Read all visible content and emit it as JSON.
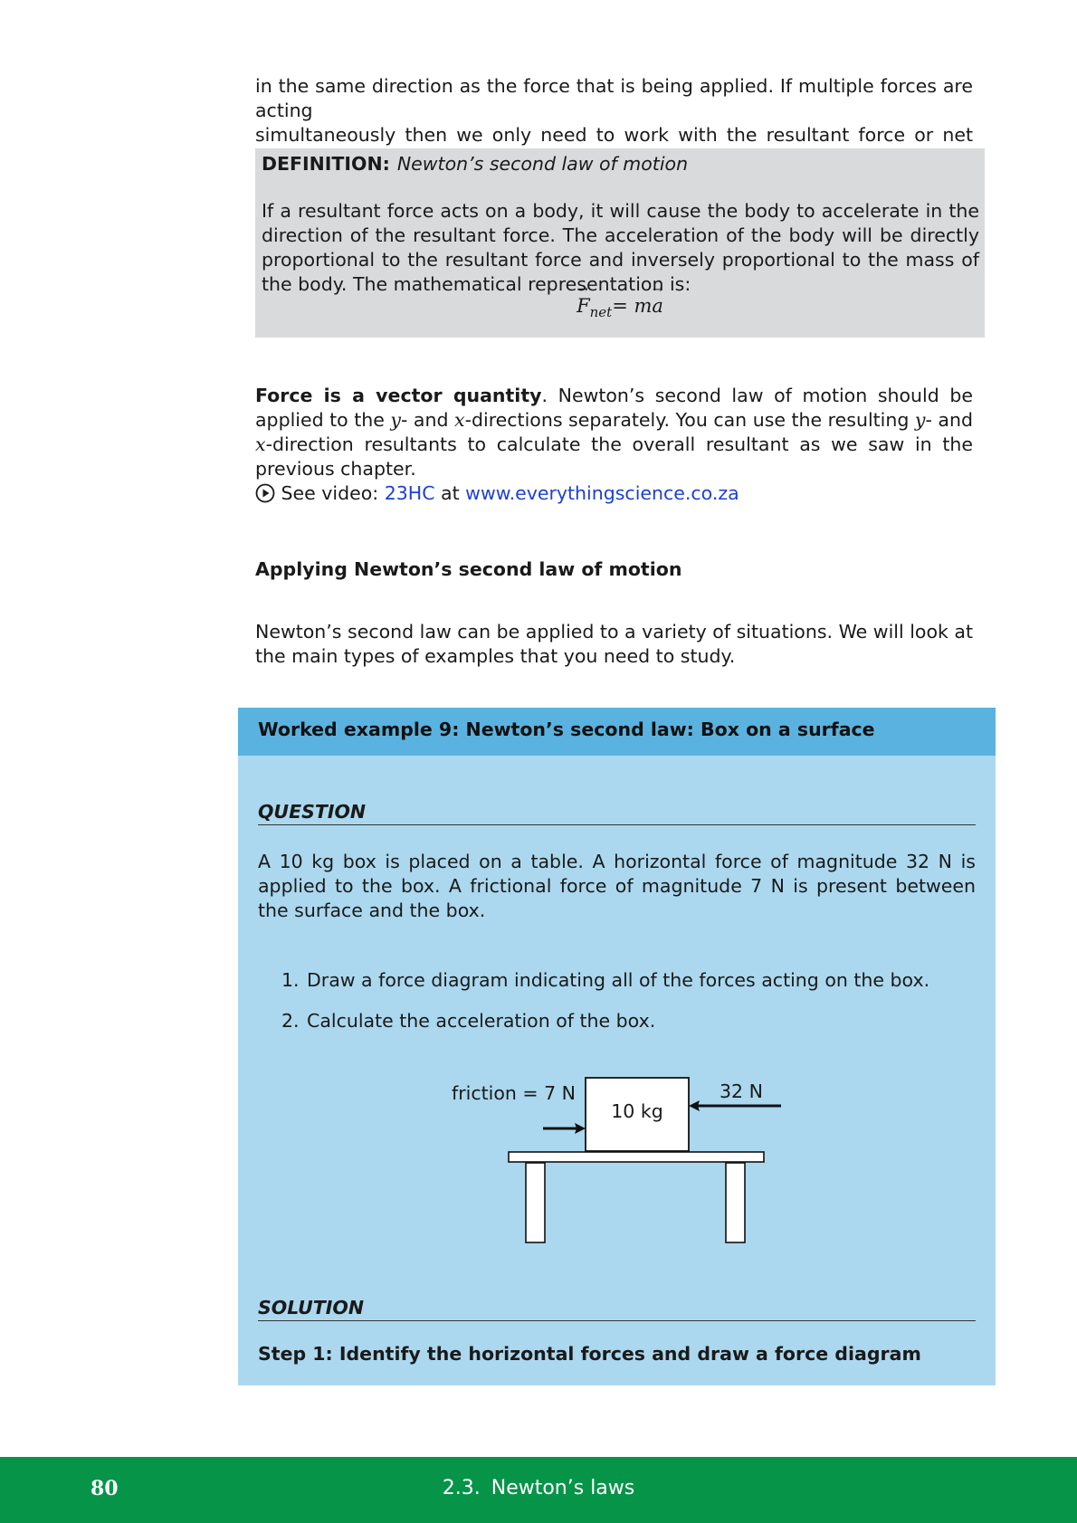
{
  "intro": {
    "line1": "in the same direction as the force that is being applied.  If multiple forces are acting",
    "line2": "simultaneously then we only need to work with the resultant force or net force."
  },
  "definition": {
    "label": "DEFINITION:",
    "title": "Newton’s second law of motion",
    "body": "If a resultant force acts on a body, it will cause the body to accelerate in the direction of the resultant force. The acceleration of the body will be directly proportional to the resultant force and inversely proportional to the mass of the body.  The mathematical representation is:",
    "formula_lhs": "F",
    "formula_sub": "net",
    "formula_rhs": " = ma"
  },
  "vector_para": {
    "bold": "Force is a vector quantity",
    "p1": ".  Newton’s second law of motion should be applied to the ",
    "y1": "y",
    "p2": "- and ",
    "x1": "x",
    "p3": "-directions separately.  You can use the resulting ",
    "y2": "y",
    "p4": "- and ",
    "x2": "x",
    "p5": "-direction resultants to calculate the overall resultant as we saw in the previous chapter."
  },
  "video": {
    "prefix": "See video: ",
    "code": "23HC",
    "at": " at ",
    "url": "www.everythingscience.co.za",
    "icon": "play-circle-icon"
  },
  "section_title": "Applying Newton’s second law of motion",
  "section_para": "Newton’s second law can be applied to a variety of situations.  We will look at the main types of examples that you need to study.",
  "worked_example": {
    "title": "Worked example 9:  Newton’s second law:  Box on a surface",
    "question_heading": "QUESTION",
    "question_text": "A 10 kg box is placed on a table.  A horizontal force of magnitude 32 N is applied to the box.  A frictional force of magnitude 7 N is present between the surface and the box.",
    "tasks": [
      {
        "num": "1.",
        "text": "Draw a force diagram indicating all of the forces acting on the box."
      },
      {
        "num": "2.",
        "text": "Calculate the acceleration of the box."
      }
    ],
    "diagram": {
      "friction_label": "friction  =  7 N",
      "applied_label": "32 N",
      "mass_label": "10 kg"
    },
    "solution_heading": "SOLUTION",
    "step1": "Step 1: Identify the horizontal forces and draw a force diagram"
  },
  "footer": {
    "page_number": "80",
    "section_number": "2.3.",
    "section_title": "Newton’s laws",
    "background": "#069448"
  },
  "colors": {
    "definition_bg": "#d9dadb",
    "worked_header_bg": "#5ab2e0",
    "worked_body_bg": "#abd8ee",
    "link": "#1d3fd6"
  }
}
